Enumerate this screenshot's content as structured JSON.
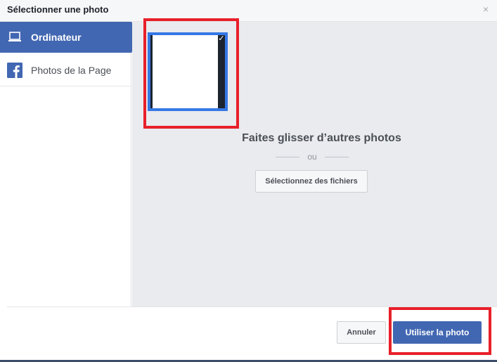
{
  "dialog": {
    "title": "Sélectionner une photo",
    "close_icon": "×"
  },
  "sidebar": {
    "items": [
      {
        "label": "Ordinateur",
        "icon": "laptop-icon",
        "active": true
      },
      {
        "label": "Photos de la Page",
        "icon": "facebook-icon",
        "active": false
      }
    ]
  },
  "main": {
    "thumbnail_check": "✓",
    "drag_text": "Faites glisser d’autres photos",
    "or_text": "ou",
    "select_files_label": "Sélectionnez des fichiers"
  },
  "footer": {
    "cancel_label": "Annuler",
    "use_photo_label": "Utiliser la photo"
  },
  "colors": {
    "accent": "#4267b2",
    "highlight": "#e8202a",
    "selection": "#3578e5"
  }
}
